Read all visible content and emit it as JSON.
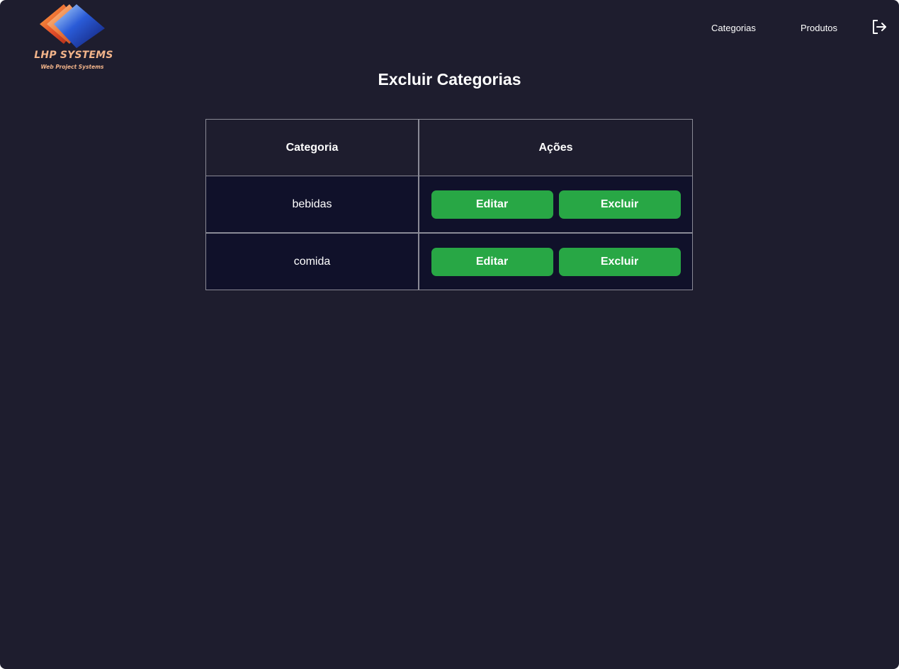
{
  "brand": {
    "name": "LHP SYSTEMS",
    "tagline": "Web Project Systems",
    "logo_icon": "stacked-diamonds-logo",
    "colors": {
      "text": "#f2b48a",
      "front": "#2a5bd7",
      "back": "#e5502a"
    }
  },
  "nav": {
    "items": [
      {
        "label": "Categorias"
      },
      {
        "label": "Produtos"
      }
    ],
    "logout_icon": "logout-icon"
  },
  "page": {
    "title": "Excluir Categorias",
    "background": "#1e1d2e"
  },
  "table": {
    "columns": [
      "Categoria",
      "Ações"
    ],
    "rows": [
      {
        "categoria": "bebidas",
        "edit_label": "Editar",
        "delete_label": "Excluir"
      },
      {
        "categoria": "comida",
        "edit_label": "Editar",
        "delete_label": "Excluir"
      }
    ],
    "button_color": "#28a745",
    "border_color": "#8a8a96",
    "row_background": "#10112a"
  }
}
